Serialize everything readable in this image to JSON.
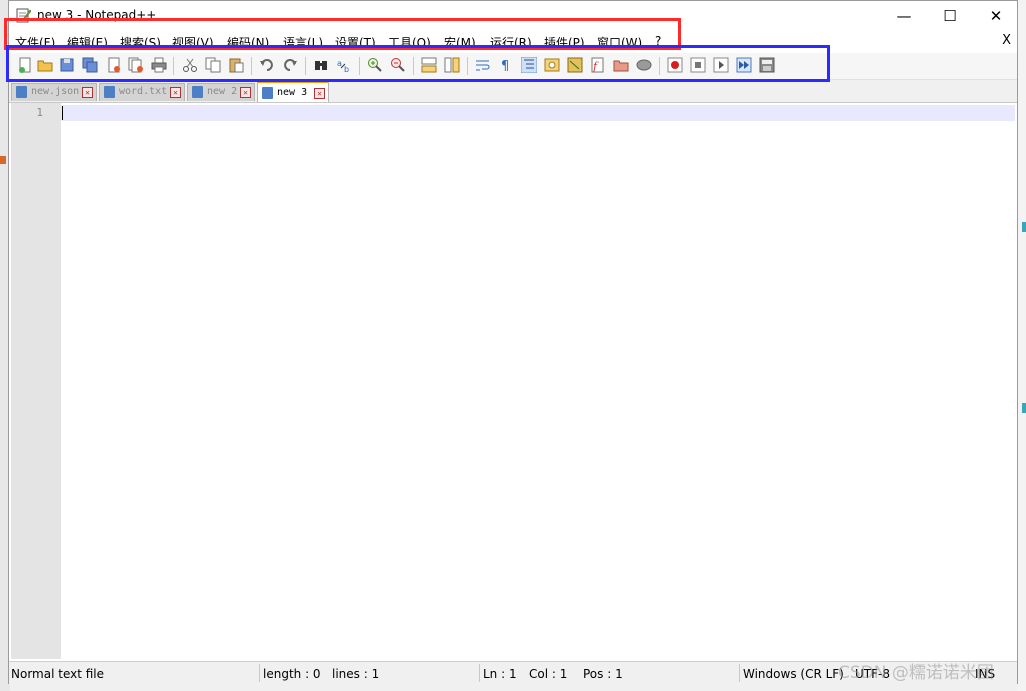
{
  "window": {
    "title": "new 3 - Notepad++",
    "minimize_glyph": "—",
    "maximize_glyph": "☐",
    "close_glyph": "✕"
  },
  "menu": {
    "items": [
      {
        "label": "文件(F)"
      },
      {
        "label": "编辑(E)"
      },
      {
        "label": "搜索(S)"
      },
      {
        "label": "视图(V)"
      },
      {
        "label": "编码(N)"
      },
      {
        "label": "语言(L)"
      },
      {
        "label": "设置(T)"
      },
      {
        "label": "工具(O)"
      },
      {
        "label": "宏(M)"
      },
      {
        "label": "运行(R)"
      },
      {
        "label": "插件(P)"
      },
      {
        "label": "窗口(W)"
      },
      {
        "label": "?"
      }
    ],
    "close_label": "X"
  },
  "toolbar": {
    "icons": [
      "new-file-icon",
      "open-file-icon",
      "save-icon",
      "save-all-icon",
      "close-icon",
      "close-all-icon",
      "print-icon",
      "cut-icon",
      "copy-icon",
      "paste-icon",
      "undo-icon",
      "redo-icon",
      "find-icon",
      "replace-icon",
      "zoom-in-icon",
      "zoom-out-icon",
      "sync-vertical-icon",
      "sync-horizontal-icon",
      "word-wrap-icon",
      "show-all-chars-icon",
      "indent-guide-icon",
      "define-language-icon",
      "document-map-icon",
      "function-list-icon",
      "folder-workspace-icon",
      "monitoring-icon",
      "record-macro-icon",
      "stop-record-icon",
      "play-macro-icon",
      "run-macro-multiple-icon",
      "save-macro-icon"
    ]
  },
  "tabs": [
    {
      "label": "new.json",
      "active": false
    },
    {
      "label": "word.txt",
      "active": false
    },
    {
      "label": "new 2",
      "active": false
    },
    {
      "label": "new 3",
      "active": true
    }
  ],
  "editor": {
    "line_number": "1"
  },
  "status": {
    "file_type": "Normal text file",
    "length": "length : 0",
    "lines": "lines : 1",
    "ln": "Ln : 1",
    "col": "Col : 1",
    "pos": "Pos : 1",
    "eol": "Windows (CR LF)",
    "encoding": "UTF-8",
    "mode": "INS"
  },
  "watermark": "CSDN @糯诺诺米团",
  "colors": {
    "highlight_red": "#ff2b2b",
    "highlight_blue": "#2b2bff",
    "active_tab_accent": "#f0a000"
  }
}
